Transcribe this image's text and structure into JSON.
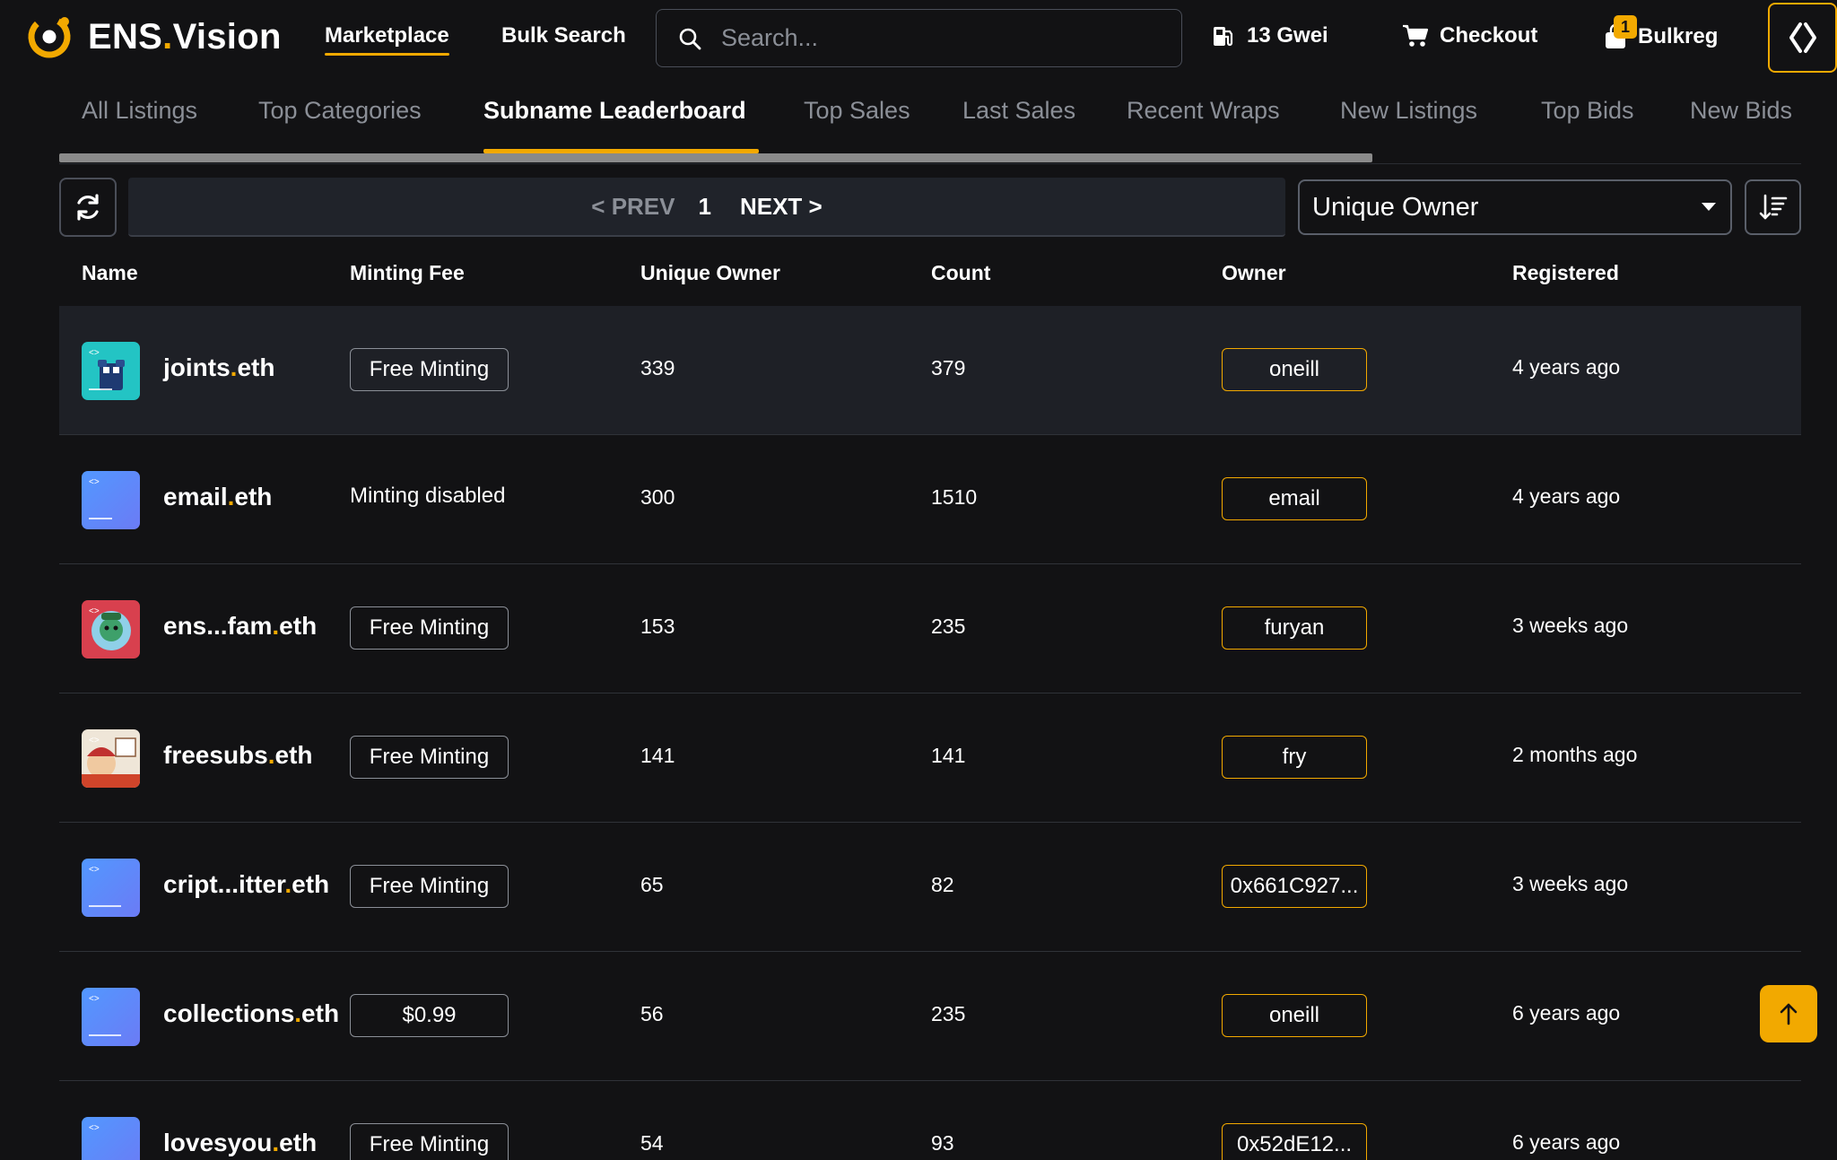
{
  "brand": {
    "name_part1": "ENS",
    "dot": ".",
    "name_part2": "Vision"
  },
  "nav": {
    "marketplace": "Marketplace",
    "bulk_search": "Bulk Search"
  },
  "search": {
    "placeholder": "Search..."
  },
  "gas": {
    "label": "13 Gwei"
  },
  "checkout": {
    "label": "Checkout"
  },
  "bulkreg": {
    "label": "Bulkreg",
    "badge": "1"
  },
  "tabs": [
    {
      "label": "All Listings",
      "active": false
    },
    {
      "label": "Top Categories",
      "active": false
    },
    {
      "label": "Subname Leaderboard",
      "active": true
    },
    {
      "label": "Top Sales",
      "active": false
    },
    {
      "label": "Last Sales",
      "active": false
    },
    {
      "label": "Recent Wraps",
      "active": false
    },
    {
      "label": "New Listings",
      "active": false
    },
    {
      "label": "Top Bids",
      "active": false
    },
    {
      "label": "New Bids",
      "active": false
    }
  ],
  "pager": {
    "prev": "< PREV",
    "page": "1",
    "next": "NEXT >"
  },
  "sort": {
    "selected": "Unique Owner"
  },
  "table": {
    "headers": {
      "name": "Name",
      "minting_fee": "Minting Fee",
      "unique_owner": "Unique Owner",
      "count": "Count",
      "owner": "Owner",
      "registered": "Registered"
    },
    "rows": [
      {
        "name": "joints",
        "tld": "eth",
        "fee": "Free Minting",
        "fee_pill": true,
        "unique_owner": "339",
        "count": "379",
        "owner": "oneill",
        "registered": "4 years ago",
        "avatar": "joints-avatar"
      },
      {
        "name": "email",
        "tld": "eth",
        "fee": "Minting disabled",
        "fee_pill": false,
        "unique_owner": "300",
        "count": "1510",
        "owner": "email",
        "registered": "4 years ago",
        "avatar": "email-avatar"
      },
      {
        "name": "ens...fam",
        "tld": "eth",
        "fee": "Free Minting",
        "fee_pill": true,
        "unique_owner": "153",
        "count": "235",
        "owner": "furyan",
        "registered": "3 weeks ago",
        "avatar": "fam-avatar"
      },
      {
        "name": "freesubs",
        "tld": "eth",
        "fee": "Free Minting",
        "fee_pill": true,
        "unique_owner": "141",
        "count": "141",
        "owner": "fry",
        "registered": "2 months ago",
        "avatar": "freesubs-avatar"
      },
      {
        "name": "cript...itter",
        "tld": "eth",
        "fee": "Free Minting",
        "fee_pill": true,
        "unique_owner": "65",
        "count": "82",
        "owner": "0x661C927...",
        "registered": "3 weeks ago",
        "avatar": "criptwitter-avatar"
      },
      {
        "name": "collections",
        "tld": "eth",
        "fee": "$0.99",
        "fee_pill": true,
        "unique_owner": "56",
        "count": "235",
        "owner": "oneill",
        "registered": "6 years ago",
        "avatar": "collections-avatar"
      },
      {
        "name": "lovesyou",
        "tld": "eth",
        "fee": "Free Minting",
        "fee_pill": true,
        "unique_owner": "54",
        "count": "93",
        "owner": "0x52dE12...",
        "registered": "6 years ago",
        "avatar": "lovesyou-avatar"
      }
    ]
  },
  "colors": {
    "accent": "#f2a900",
    "background": "#121214",
    "row_highlight": "#1e2026"
  }
}
